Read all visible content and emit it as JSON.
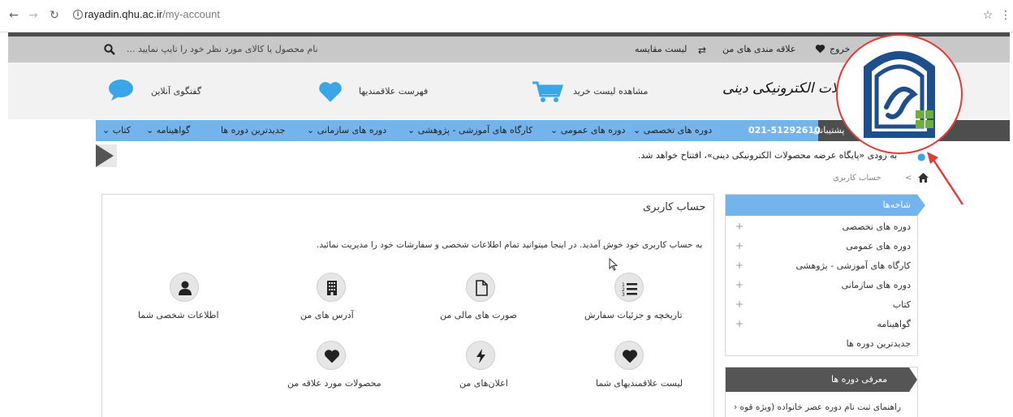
{
  "browser": {
    "url_host": "rayadin.qhu.ac.ir",
    "url_path": "/my-account"
  },
  "topbar": {
    "logout": "خروج",
    "wishlist": "علاقه مندی های من",
    "compare": "لیست مقایسه",
    "search_placeholder": "نام محصول یا کالای مورد نظر خود را تایپ نمایید ..."
  },
  "header": {
    "brand_text": "پایگاه عرضه محصولات الکترونیکی دینی",
    "cart": "مشاهده لیست خرید",
    "favorites": "فهرست علاقمندیها",
    "chat": "گفتگوی آنلاین"
  },
  "menu": {
    "support": "پشتیبانی",
    "phone": "021-51292610",
    "items": [
      "دوره های تخصصی",
      "دوره های عمومی",
      "کارگاه های آموزشی - پژوهشی",
      "دوره های سازمانی",
      "جدیدترین دوره ها",
      "گواهینامه",
      "کتاب"
    ]
  },
  "news": {
    "text": "به زودی «پایگاه عرضه محصولات الکترونیکی دینی»، افتتاح خواهد شد."
  },
  "breadcrumb": {
    "current": "حساب کاربری",
    "sep": ">"
  },
  "account": {
    "title": "حساب کاربری",
    "welcome": "به حساب کاربری خود خوش آمدید. در اینجا میتوانید تمام اطلاعات شخصی و سفارشات خود را مدیریت نمائید.",
    "tiles": [
      {
        "label": "تاریخچه و جزئیات سفارش",
        "icon": "order-list-icon"
      },
      {
        "label": "صورت های مالی من",
        "icon": "document-icon"
      },
      {
        "label": "آدرس های من",
        "icon": "building-icon"
      },
      {
        "label": "اطلاعات شخصی شما",
        "icon": "user-icon"
      },
      {
        "label": "لیست علاقمندیهای شما",
        "icon": "heart-icon"
      },
      {
        "label": "اعلان‌های من",
        "icon": "lightning-icon"
      },
      {
        "label": "محصولات مورد علاقه من",
        "icon": "heart-icon"
      }
    ]
  },
  "sidebar": {
    "branches_title": "شاخه‌ها",
    "items": [
      "دوره های تخصصی",
      "دوره های عمومی",
      "کارگاه های آموزشی - پژوهشی",
      "دوره های سازمانی",
      "کتاب",
      "گواهینامه",
      "جدیدترین دوره ها"
    ],
    "intro_title": "معرفی دوره ها",
    "intro_item": "راهنمای ثبت نام دوره عصر خانواده (ویژه قوه"
  },
  "colors": {
    "menu_blue": "#74b4ec",
    "dark": "#4e4e4e",
    "annotation_red": "#e53935"
  }
}
